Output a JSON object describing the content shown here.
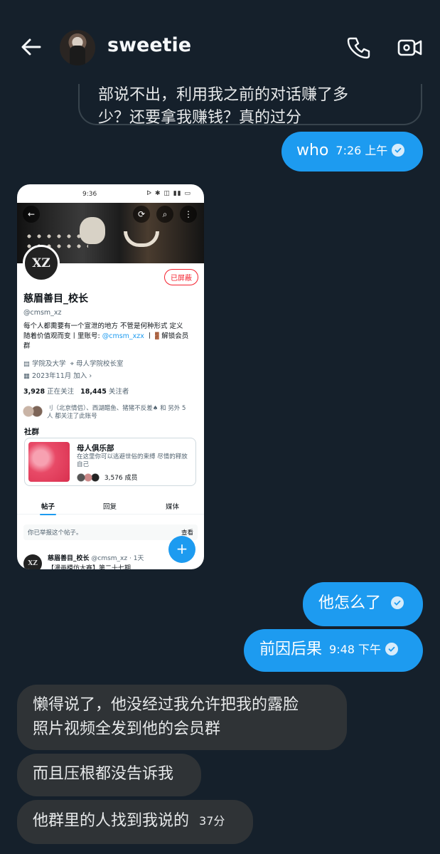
{
  "header": {
    "contact_name": "sweetie"
  },
  "quoted_message": {
    "line1": "部说不出，利用我之前的对话赚了多",
    "line2": "少？还要拿我赚钱？真的过分"
  },
  "messages": {
    "who": {
      "text": "who",
      "time": "7:26 上午"
    },
    "what_happened": {
      "text": "他怎么了"
    },
    "cause_effect": {
      "text": "前因后果",
      "time": "9:48 下午"
    },
    "reply1": {
      "line1": "懒得说了，他没经过我允许把我的露脸",
      "line2": "照片视频全发到他的会员群"
    },
    "reply2": {
      "text": "而且压根都没告诉我"
    },
    "reply3": {
      "text": "他群里的人找到我说的",
      "time": "37分"
    }
  },
  "screenshot": {
    "status_time": "9:36",
    "status_icons": "ᐅ ✱ ◫ ▮▮ ▭",
    "avatar_text": "XZ",
    "blocked_label": "已屏蔽",
    "name": "慈眉善目_校长",
    "handle": "@cmsm_xz",
    "bio_line1": "每个人都需要有一个宣泄的地方 不管是何种形式 定义",
    "bio_line2_a": "随着价值观而变丨里账号: ",
    "bio_link": "@cmsm_xzx",
    "bio_line2_b": " 丨🚪解锁会员",
    "bio_line3": "群",
    "category": "学院及大学",
    "location": "母人学院校长室",
    "joined": "2023年11月 加入",
    "following_count": "3,928",
    "following_label": "正在关注",
    "followers_count": "18,445",
    "followers_label": "关注者",
    "mutual_line1": "刂（北京情侣）、西湖醋鱼、猪猪不反差♠ 和 另外 5",
    "mutual_line2": "人 都关注了此账号",
    "community_label": "社群",
    "community_title": "母人俱乐部",
    "community_desc": "在这里你可以逃避世俗的束缚 尽情的释放自己",
    "community_members": "3,576 成员",
    "tabs": [
      "帖子",
      "回复",
      "媒体"
    ],
    "report_text": "你已举报这个帖子。",
    "report_view": "查看",
    "fab": "+",
    "post_author": "慈眉善目_校长",
    "post_meta": "@cmsm_xz · 1天",
    "post_text": "【漫画模仿大赛】第二十七期"
  },
  "colors": {
    "background": "#15202b",
    "outgoing_bubble": "#1d9bf0",
    "incoming_bubble": "#2f3336"
  }
}
